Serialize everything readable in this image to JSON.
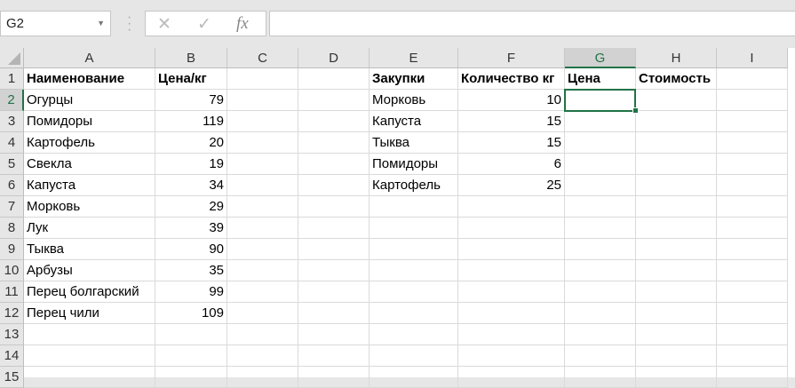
{
  "formula_bar": {
    "name_box": "G2",
    "cancel_icon": "✕",
    "enter_icon": "✓",
    "fx_label": "fx",
    "formula": ""
  },
  "columns": [
    "A",
    "B",
    "C",
    "D",
    "E",
    "F",
    "G",
    "H",
    "I"
  ],
  "selected_cell": "G2",
  "rows": [
    "1",
    "2",
    "3",
    "4",
    "5",
    "6",
    "7",
    "8",
    "9",
    "10",
    "11",
    "12",
    "13",
    "14",
    "15"
  ],
  "cells": {
    "A": [
      "Наименование",
      "Огурцы",
      "Помидоры",
      "Картофель",
      "Свекла",
      "Капуста",
      "Морковь",
      "Лук",
      "Тыква",
      "Арбузы",
      "Перец болгарский",
      "Перец чили"
    ],
    "B": [
      "Цена/кг",
      "79",
      "119",
      "20",
      "19",
      "34",
      "29",
      "39",
      "90",
      "35",
      "99",
      "109"
    ],
    "E": [
      "Закупки",
      "Морковь",
      "Капуста",
      "Тыква",
      "Помидоры",
      "Картофель"
    ],
    "F": [
      "Количество кг",
      "10",
      "15",
      "15",
      "6",
      "25"
    ],
    "G": [
      "Цена"
    ],
    "H": [
      "Стоимость"
    ]
  }
}
